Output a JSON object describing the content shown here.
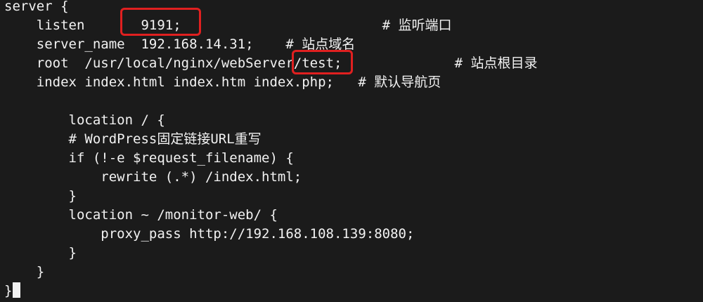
{
  "terminal": {
    "lines": [
      "server {",
      "    listen       9191;                         # 监听端口",
      "    server_name  192.168.14.31;    # 站点域名",
      "    root  /usr/local/nginx/webServer/test;              # 站点根目录",
      "    index index.html index.htm index.php;   # 默认导航页",
      "",
      "        location / {",
      "        # WordPress固定链接URL重写",
      "        if (!-e $request_filename) {",
      "            rewrite (.*) /index.html;",
      "        }",
      "        location ~ /monitor-web/ {",
      "            proxy_pass http://192.168.108.139:8080;",
      "        }",
      "    }",
      "}"
    ]
  },
  "colors": {
    "background": "#1b1b1b",
    "text": "#f2f2f2",
    "highlight": "#e02020"
  }
}
